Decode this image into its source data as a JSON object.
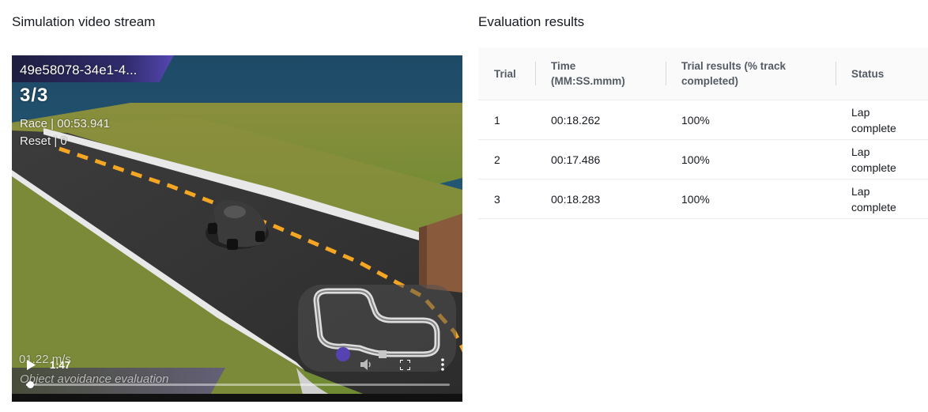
{
  "left_panel": {
    "title": "Simulation video stream"
  },
  "right_panel": {
    "title": "Evaluation results"
  },
  "video": {
    "model_id": "49e58078-34e1-4...",
    "lap": "3/3",
    "race_time": "Race | 00:53.941",
    "reset_count": "Reset | 0",
    "speed": "01.22 m/s",
    "mode": "Object avoidance evaluation",
    "player": {
      "current_time": "1:47",
      "progress_fraction": 0.01,
      "play_icon": "play-icon",
      "volume_icon": "volume-icon",
      "fullscreen_icon": "fullscreen-icon",
      "more_icon": "more-vertical-icon"
    }
  },
  "results_table": {
    "columns": [
      "Trial",
      "Time (MM:SS.mmm)",
      "Trial results (% track completed)",
      "Status"
    ],
    "rows": [
      {
        "trial": "1",
        "time": "00:18.262",
        "result": "100%",
        "status": "Lap complete"
      },
      {
        "trial": "2",
        "time": "00:17.486",
        "result": "100%",
        "status": "Lap complete"
      },
      {
        "trial": "3",
        "time": "00:18.283",
        "result": "100%",
        "status": "Lap complete"
      }
    ]
  },
  "colors": {
    "lane_marking": "#f5a623",
    "table_header_bg": "#fafafa",
    "border": "#eaeded",
    "overlay_purple": "#5a44b8"
  }
}
